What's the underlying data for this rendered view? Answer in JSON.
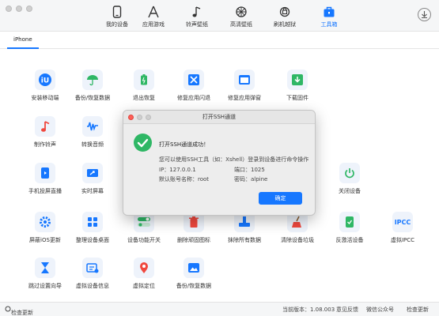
{
  "nav": [
    {
      "label": "我的设备",
      "icon": "phone-icon"
    },
    {
      "label": "应用游戏",
      "icon": "apps-icon"
    },
    {
      "label": "铃声壁纸",
      "icon": "music-icon"
    },
    {
      "label": "高清壁纸",
      "icon": "wallpaper-icon"
    },
    {
      "label": "刷机越狱",
      "icon": "flash-icon"
    },
    {
      "label": "工具箱",
      "icon": "toolbox-icon",
      "active": true
    }
  ],
  "subtab": "iPhone",
  "tools": [
    {
      "label": "安装移动端",
      "icon": "iu-logo-icon",
      "color": "#1677ff"
    },
    {
      "label": "备份/恢复数据",
      "icon": "umbrella-icon",
      "color": "#2fb765"
    },
    {
      "label": "退出恢复",
      "icon": "battery-icon",
      "color": "#2fb765"
    },
    {
      "label": "修复应用闪退",
      "icon": "repair-icon",
      "color": "#1677ff"
    },
    {
      "label": "修复应用弹窗",
      "icon": "window-icon",
      "color": "#1677ff"
    },
    {
      "label": "下载固件",
      "icon": "download-icon",
      "color": "#2fb765"
    },
    {
      "label": "制作铃声",
      "icon": "music-note-icon",
      "color": "#f0483e"
    },
    {
      "label": "转换音频",
      "icon": "waveform-icon",
      "color": "#1677ff"
    },
    {
      "label": "手机投屏直播",
      "icon": "phone-play-icon",
      "color": "#1677ff"
    },
    {
      "label": "实时屏幕",
      "icon": "share-screen-icon",
      "color": "#1677ff"
    },
    {
      "label": "关闭设备",
      "icon": "power-icon",
      "color": "#2fb765"
    },
    {
      "label": "屏蔽iOS更新",
      "icon": "gear-icon",
      "color": "#1677ff"
    },
    {
      "label": "整理设备桌面",
      "icon": "grid-icon",
      "color": "#1677ff"
    },
    {
      "label": "设备功能开关",
      "icon": "toggle-icon",
      "color": "#2fb765"
    },
    {
      "label": "删除顽固图标",
      "icon": "trash-icon",
      "color": "#f0483e"
    },
    {
      "label": "抹除所有数据",
      "icon": "eraser-icon",
      "color": "#1677ff"
    },
    {
      "label": "清除设备垃圾",
      "icon": "broom-icon",
      "color": "#f0483e"
    },
    {
      "label": "反激活设备",
      "icon": "phone-check-icon",
      "color": "#2fb765"
    },
    {
      "label": "虚拟IPCC",
      "icon": "ipcc-icon",
      "color": "#1677ff"
    },
    {
      "label": "跳过设置向导",
      "icon": "hourglass-icon",
      "color": "#1677ff"
    },
    {
      "label": "虚拟设备信息",
      "icon": "device-info-icon",
      "color": "#1677ff"
    },
    {
      "label": "虚拟定位",
      "icon": "location-pin-icon",
      "color": "#f0483e"
    },
    {
      "label": "备份/恢复数据",
      "icon": "photo-icon",
      "color": "#1677ff"
    }
  ],
  "status": {
    "left": "检查更新",
    "version": "当前版本：1.08.003",
    "feedback": "意见反馈",
    "wechat": "微信公众号",
    "update": "检查更新"
  },
  "dialog": {
    "title": "打开SSH通道",
    "headline": "打开SSH通道成功！",
    "line1": "您可以使用SSH工具（如：Xshell）登录到设备进行命令操作",
    "ip_label": "IP：",
    "ip": "127.0.0.1",
    "port_label": "端口：",
    "port": "1025",
    "user_label": "默认账号名称：",
    "user": "root",
    "pass_label": "密码：",
    "pass": "alpine",
    "ok": "确定"
  }
}
